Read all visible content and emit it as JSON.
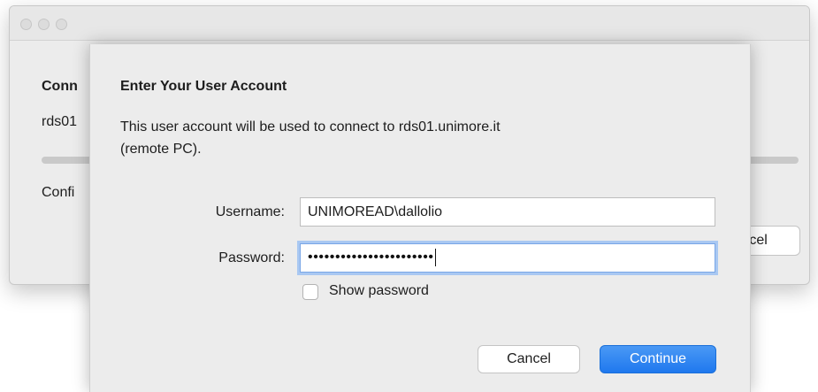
{
  "background_window": {
    "heading": "Conn",
    "host_text": "rds01",
    "status_text": "Confi",
    "cancel_label": "Cancel"
  },
  "dialog": {
    "title": "Enter Your User Account",
    "description_line1": "This user account will be used to connect to rds01.unimore.it",
    "description_line2": "(remote PC).",
    "username_label": "Username:",
    "username_value": "UNIMOREAD\\dallolio",
    "password_label": "Password:",
    "password_masked": "•••••••••••••••••••••••",
    "show_password_label": "Show password",
    "show_password_checked": false,
    "cancel_label": "Cancel",
    "continue_label": "Continue"
  },
  "colors": {
    "accent": "#1f78ee",
    "focus_ring": "#a9c8f2",
    "window_bg": "#ececec"
  }
}
